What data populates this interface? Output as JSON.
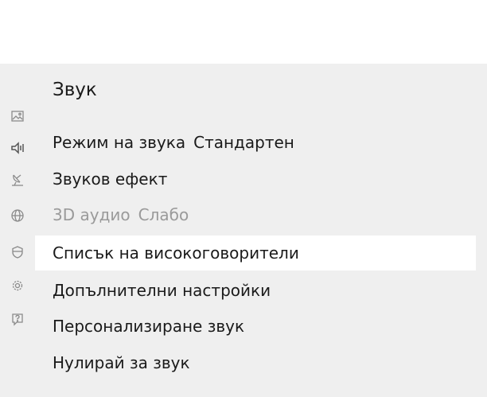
{
  "menu": {
    "title": "Звук",
    "items": [
      {
        "label": "Режим на звука",
        "value": "Стандартен",
        "enabled": true,
        "selected": false
      },
      {
        "label": "Звуков ефект",
        "enabled": true,
        "selected": false
      },
      {
        "label": "3D аудио",
        "value": "Слабо",
        "enabled": false,
        "selected": false
      },
      {
        "label": "Списък на високоговорители",
        "enabled": true,
        "selected": true
      },
      {
        "label": "Допълнителни настройки",
        "enabled": true,
        "selected": false
      },
      {
        "label": "Персонализиране звук",
        "enabled": true,
        "selected": false
      },
      {
        "label": "Нулирай за звук",
        "enabled": true,
        "selected": false
      }
    ]
  },
  "icon_rail": [
    {
      "icon": "picture-icon"
    },
    {
      "icon": "speaker-icon"
    },
    {
      "icon": "satellite-dish-icon"
    },
    {
      "icon": "globe-icon"
    },
    {
      "icon": "shield-icon"
    },
    {
      "icon": "settings-gear-icon"
    },
    {
      "icon": "help-icon"
    }
  ],
  "colors": {
    "panel_background": "#efefef",
    "selected_background": "#ffffff",
    "text": "#1a1a1a",
    "disabled_text": "#9a9a9a",
    "icon": "#8a8a8a"
  }
}
